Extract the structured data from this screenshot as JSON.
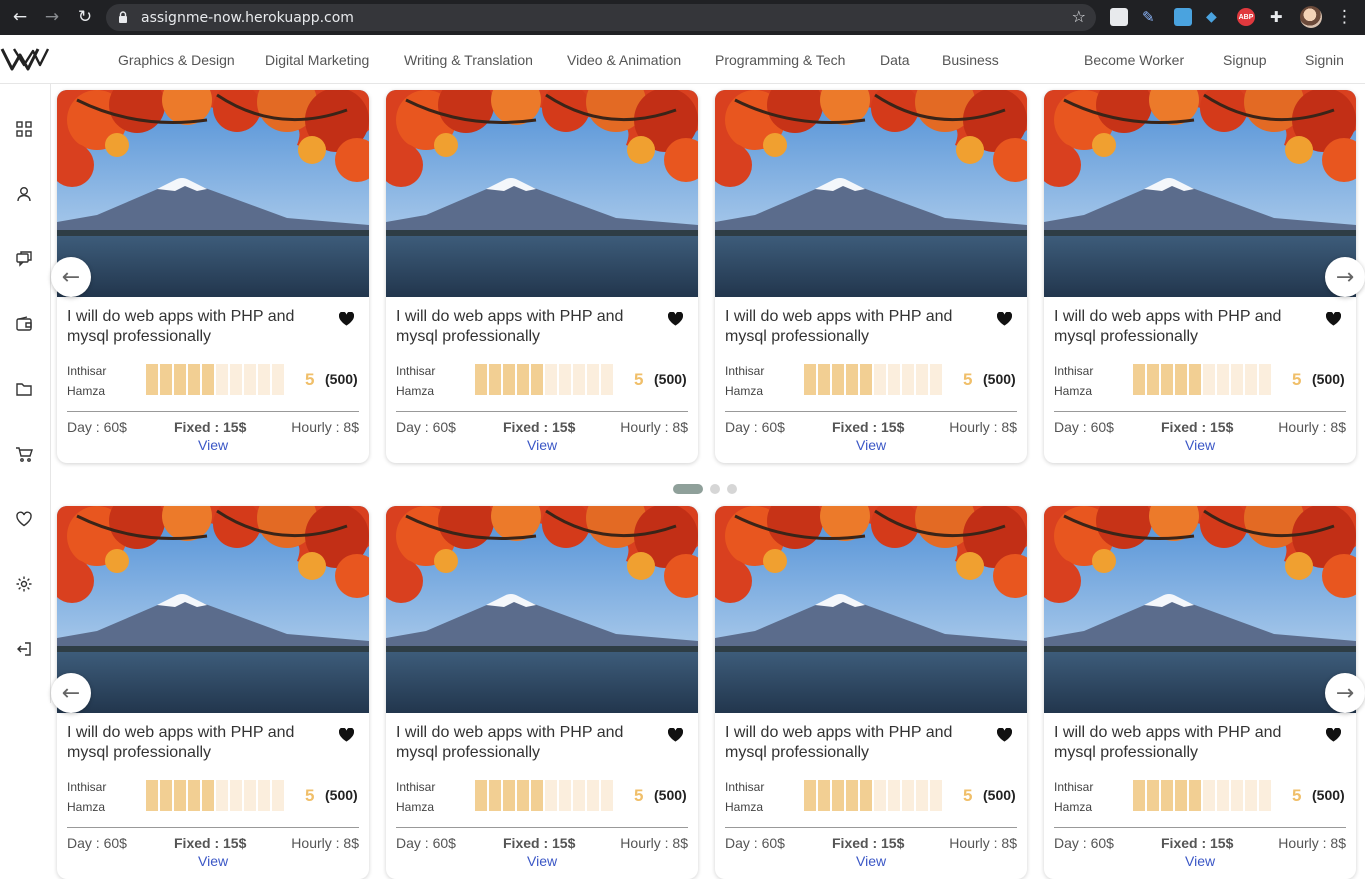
{
  "browser": {
    "url": "assignme-now.herokuapp.com",
    "abp_label": "ABP"
  },
  "nav": {
    "categories": [
      "Graphics & Design",
      "Digital Marketing",
      "Writing & Translation",
      "Video & Animation",
      "Programming & Tech",
      "Data",
      "Business"
    ],
    "become_worker": "Become Worker",
    "signup": "Signup",
    "signin": "Signin"
  },
  "sidebar": {
    "icons": [
      "dashboard-icon",
      "user-icon",
      "chat-icon",
      "wallet-icon",
      "folder-icon",
      "cart-icon",
      "heart-icon",
      "settings-icon",
      "logout-icon"
    ]
  },
  "gig": {
    "title": "I will do web apps with PHP and mysql professionally",
    "seller_first": "Inthisar",
    "seller_last": "Hamza",
    "rating_bars_filled": 5,
    "rating_bars_total": 10,
    "score": "5",
    "reviews": "(500)",
    "day_price": "Day : 60$",
    "fixed_price": "Fixed : 15$",
    "hourly_price": "Hourly : 8$",
    "view_label": "View"
  },
  "carousel": {
    "prev_icon": "←",
    "next_icon": "→",
    "pages": 3,
    "active_page": 1
  },
  "colors": {
    "rating_filled": "#f2cf93",
    "rating_empty": "#fbeedd",
    "score": "#f0bf6a",
    "view_link": "#3b57c6",
    "active_dot": "#8fa09a"
  }
}
